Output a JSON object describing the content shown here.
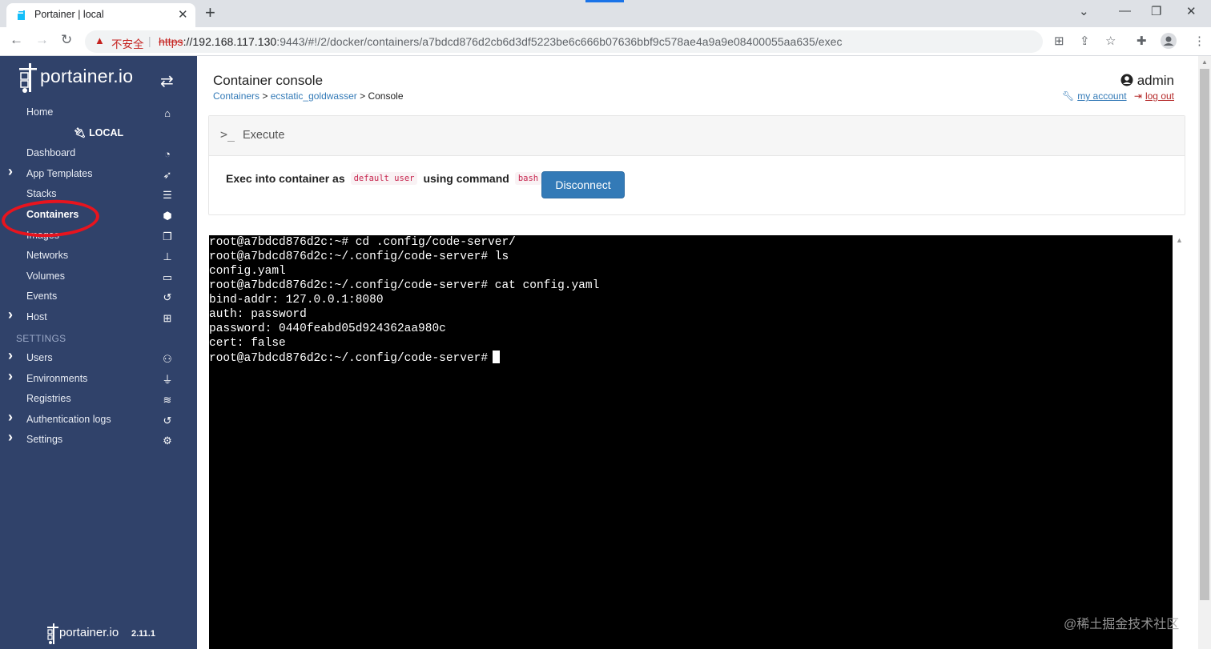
{
  "browser": {
    "tab_title": "Portainer | local",
    "tab_close": "✕",
    "new_tab": "+",
    "security_label": "不安全",
    "url_scheme": "https",
    "url_host": "://192.168.117.130",
    "url_rest": ":9443/#!/2/docker/containers/a7bdcd876d2cb6d3df5223be6c666b07636bbf9c578ae4a9a9e08400055aa635/exec"
  },
  "sidebar": {
    "logo_text": "portainer.io",
    "environment": "LOCAL",
    "settings_label": "SETTINGS",
    "items": [
      {
        "label": "Home",
        "icon": "home-icon",
        "chevron": false,
        "active": false
      },
      {
        "label": "Dashboard",
        "icon": "tachometer-icon",
        "chevron": false,
        "active": false
      },
      {
        "label": "App Templates",
        "icon": "rocket-icon",
        "chevron": true,
        "active": false
      },
      {
        "label": "Stacks",
        "icon": "th-list-icon",
        "chevron": false,
        "active": false
      },
      {
        "label": "Containers",
        "icon": "cubes-icon",
        "chevron": false,
        "active": true
      },
      {
        "label": "Images",
        "icon": "clone-icon",
        "chevron": false,
        "active": false
      },
      {
        "label": "Networks",
        "icon": "sitemap-icon",
        "chevron": false,
        "active": false
      },
      {
        "label": "Volumes",
        "icon": "hdd-icon",
        "chevron": false,
        "active": false
      },
      {
        "label": "Events",
        "icon": "history-icon",
        "chevron": false,
        "active": false
      },
      {
        "label": "Host",
        "icon": "th-icon",
        "chevron": true,
        "active": false
      },
      {
        "label": "Users",
        "icon": "users-icon",
        "chevron": true,
        "active": false
      },
      {
        "label": "Environments",
        "icon": "plug-icon",
        "chevron": true,
        "active": false
      },
      {
        "label": "Registries",
        "icon": "database-icon",
        "chevron": false,
        "active": false
      },
      {
        "label": "Authentication logs",
        "icon": "history-icon",
        "chevron": true,
        "active": false
      },
      {
        "label": "Settings",
        "icon": "cogs-icon",
        "chevron": true,
        "active": false
      }
    ],
    "footer_logo": "portainer.io",
    "version": "2.11.1"
  },
  "header": {
    "title": "Container console",
    "breadcrumb": {
      "containers": "Containers",
      "sep1": " > ",
      "container_name": "ecstatic_goldwasser",
      "sep2": " > ",
      "current": "Console"
    },
    "user": "admin",
    "my_account": "my account",
    "log_out": "log out"
  },
  "execute": {
    "title": "Execute",
    "text_prefix": "Exec into container as",
    "user_code": "default user",
    "text_mid": "using command",
    "command_code": "bash",
    "button_label": "Disconnect"
  },
  "terminal": {
    "lines": [
      "root@a7bdcd876d2c:~# cd .config/code-server/",
      "root@a7bdcd876d2c:~/.config/code-server# ls",
      "config.yaml",
      "root@a7bdcd876d2c:~/.config/code-server# cat config.yaml",
      "bind-addr: 127.0.0.1:8080",
      "auth: password",
      "password: 0440feabd05d924362aa980c",
      "cert: false",
      "root@a7bdcd876d2c:~/.config/code-server#"
    ]
  },
  "watermark": "@稀土掘金技术社区",
  "colors": {
    "sidebar_bg": "#30426a",
    "accent_blue": "#337ab7",
    "annotation_red": "#e8141e"
  }
}
